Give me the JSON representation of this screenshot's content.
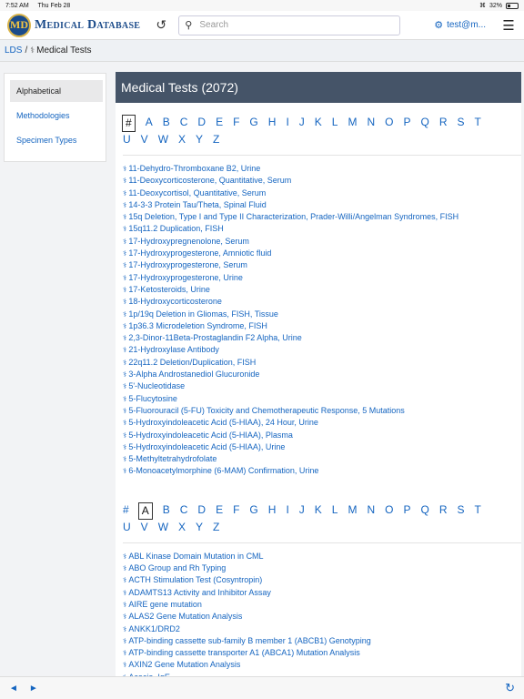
{
  "status": {
    "time": "7:52 AM",
    "date": "Thu Feb 28",
    "battery": "32%"
  },
  "header": {
    "logo_badge": "MD",
    "logo_text": "Medical Database",
    "search_placeholder": "Search",
    "user": "test@m..."
  },
  "breadcrumb": {
    "root": "LDS",
    "sep": "/",
    "current": "Medical Tests"
  },
  "sidebar": {
    "items": [
      {
        "label": "Alphabetical"
      },
      {
        "label": "Methodologies"
      },
      {
        "label": "Specimen Types"
      }
    ]
  },
  "main": {
    "title": "Medical Tests (2072)",
    "alphabet_row1": [
      "#",
      "A",
      "B",
      "C",
      "D",
      "E",
      "F",
      "G",
      "H",
      "I",
      "J",
      "K",
      "L",
      "M",
      "N",
      "O",
      "P",
      "Q",
      "R",
      "S",
      "T"
    ],
    "alphabet_row2": [
      "U",
      "V",
      "W",
      "X",
      "Y",
      "Z"
    ],
    "section1_tests": [
      "11-Dehydro-Thromboxane B2, Urine",
      "11-Deoxycorticosterone, Quantitative, Serum",
      "11-Deoxycortisol, Quantitative, Serum",
      "14-3-3 Protein Tau/Theta, Spinal Fluid",
      "15q Deletion, Type I and Type II Characterization, Prader-Willi/Angelman Syndromes, FISH",
      "15q11.2 Duplication, FISH",
      "17-Hydroxypregnenolone, Serum",
      "17-Hydroxyprogesterone, Amniotic fluid",
      "17-Hydroxyprogesterone, Serum",
      "17-Hydroxyprogesterone, Urine",
      "17-Ketosteroids, Urine",
      "18-Hydroxycorticosterone",
      "1p/19q Deletion in Gliomas, FISH, Tissue",
      "1p36.3 Microdeletion Syndrome, FISH",
      "2,3-Dinor-11Beta-Prostaglandin F2 Alpha, Urine",
      "21-Hydroxylase Antibody",
      "22q11.2 Deletion/Duplication, FISH",
      "3-Alpha Androstanediol Glucuronide",
      "5'-Nucleotidase",
      "5-Flucytosine",
      "5-Fluorouracil (5-FU) Toxicity and Chemotherapeutic Response, 5 Mutations",
      "5-Hydroxyindoleacetic Acid (5-HIAA), 24 Hour, Urine",
      "5-Hydroxyindoleacetic Acid (5-HIAA), Plasma",
      "5-Hydroxyindoleacetic Acid (5-HIAA), Urine",
      "5-Methyltetrahydrofolate",
      "6-Monoacetylmorphine (6-MAM) Confirmation, Urine"
    ],
    "section2_tests": [
      "ABL Kinase Domain Mutation in CML",
      "ABO Group and Rh Typing",
      "ACTH Stimulation Test (Cosyntropin)",
      "ADAMTS13 Activity and Inhibitor Assay",
      "AIRE gene mutation",
      "ALAS2 Gene Mutation Analysis",
      "ANKK1/DRD2",
      "ATP-binding cassette sub-family B member 1 (ABCB1) Genotyping",
      "ATP-binding cassette transporter A1 (ABCA1) Mutation Analysis",
      "AXIN2 Gene Mutation Analysis",
      "Acacia, IgE"
    ]
  },
  "bottombar": {
    "back": "◄",
    "forward": "►",
    "refresh": "↻"
  }
}
